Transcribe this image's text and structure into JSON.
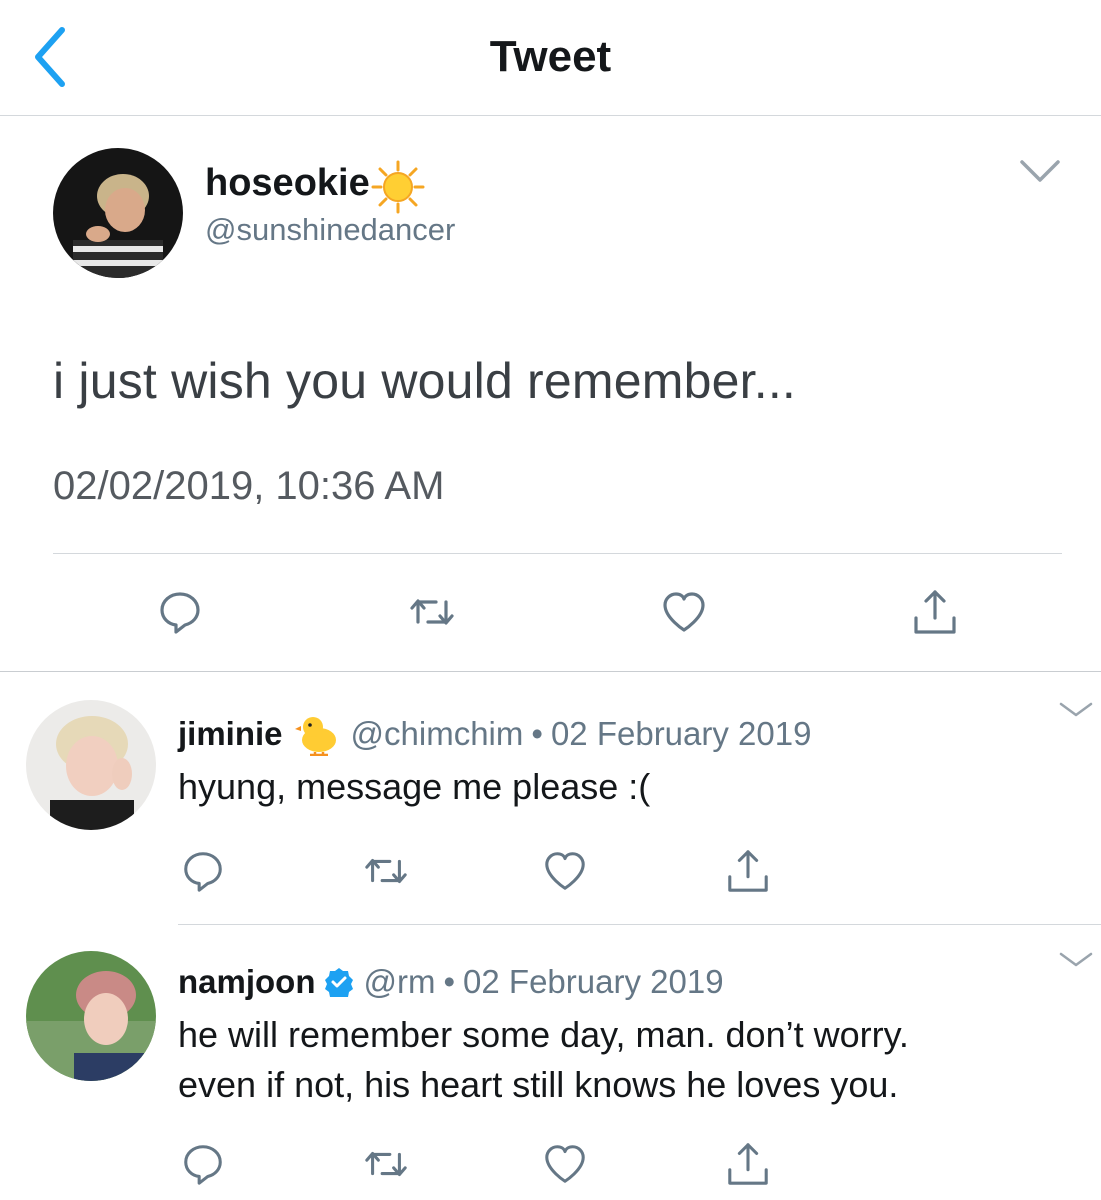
{
  "header": {
    "title": "Tweet"
  },
  "main_tweet": {
    "display_name": "hoseokie",
    "name_emoji": "sun-icon",
    "handle": "@sunshinedancer",
    "text": "i just wish you would remember...",
    "timestamp": "02/02/2019, 10:36 AM"
  },
  "replies": [
    {
      "display_name": "jiminie",
      "name_emoji": "baby-chick-icon",
      "handle": "@chimchim",
      "separator": "•",
      "date": "02 February 2019",
      "text_lines": [
        "hyung, message me please :("
      ]
    },
    {
      "display_name": "namjoon",
      "name_emoji": "verified-badge-icon",
      "handle": "@rm",
      "separator": "•",
      "date": "02 February 2019",
      "text_lines": [
        "he will remember some day, man. don’t worry.",
        "even if not, his heart still knows he loves you."
      ]
    }
  ],
  "colors": {
    "accent_blue": "#1da1f2",
    "icon_gray": "#657786",
    "text_dark": "#14171a",
    "divider": "#d4d8dc"
  }
}
